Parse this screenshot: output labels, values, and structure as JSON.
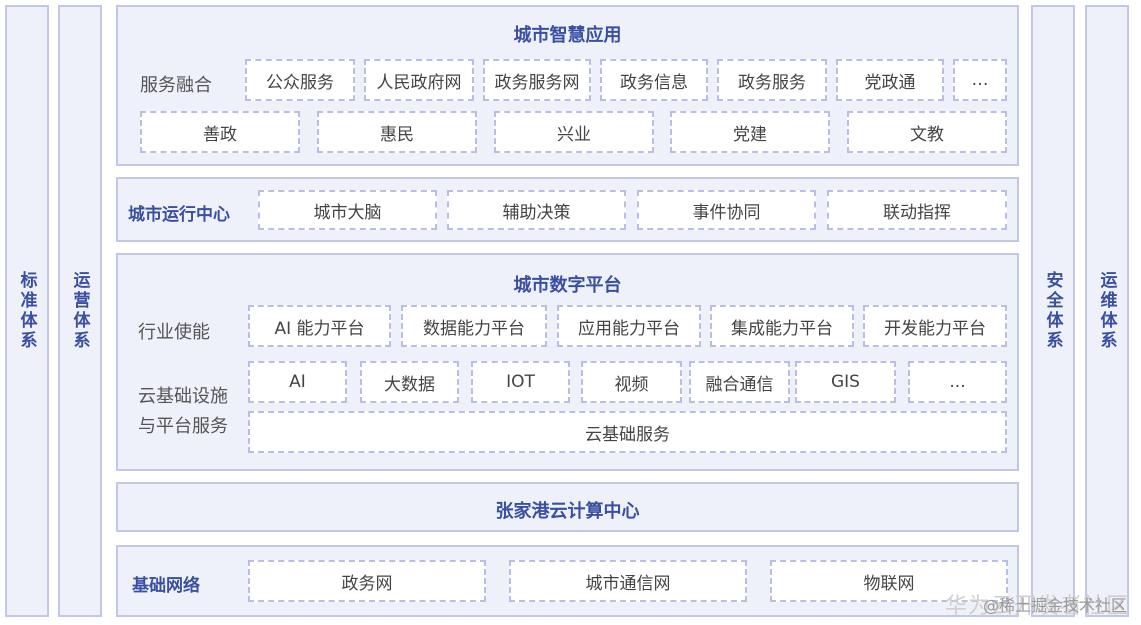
{
  "side": {
    "left1": "标准体系",
    "left2": "运营体系",
    "right1": "安全体系",
    "right2": "运维体系"
  },
  "app": {
    "title": "城市智慧应用",
    "fusion_label": "服务融合",
    "row1": [
      "公众服务",
      "人民政府网",
      "政务服务网",
      "政务信息",
      "政务服务",
      "党政通",
      "…"
    ],
    "row2": [
      "善政",
      "惠民",
      "兴业",
      "党建",
      "文教"
    ]
  },
  "ops": {
    "label": "城市运行中心",
    "items": [
      "城市大脑",
      "辅助决策",
      "事件协同",
      "联动指挥"
    ]
  },
  "digital": {
    "title": "城市数字平台",
    "enable_label": "行业使能",
    "enable_items": [
      "AI 能力平台",
      "数据能力平台",
      "应用能力平台",
      "集成能力平台",
      "开发能力平台"
    ],
    "infra_label_1": "云基础设施",
    "infra_label_2": "与平台服务",
    "infra_items": [
      "AI",
      "大数据",
      "IOT",
      "视频",
      "融合通信",
      "GIS",
      "..."
    ],
    "cloud_base": "云基础服务"
  },
  "cloud_center": "张家港云计算中心",
  "network": {
    "label": "基础网络",
    "items": [
      "政务网",
      "城市通信网",
      "物联网"
    ]
  },
  "watermark": {
    "main": "华为云开发者社区",
    "sub": "@稀土掘金技术社区"
  }
}
